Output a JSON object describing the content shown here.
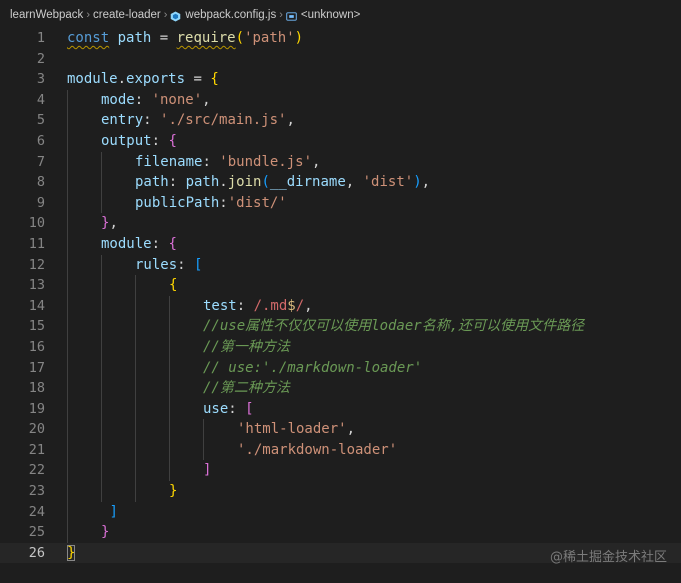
{
  "breadcrumb": {
    "items": [
      "learnWebpack",
      "create-loader",
      "webpack.config.js",
      "<unknown>"
    ],
    "separator": "›"
  },
  "code": {
    "lines": [
      {
        "n": "1",
        "indent": 0,
        "tokens": [
          [
            "kw",
            "const"
          ],
          [
            "op",
            " "
          ],
          [
            "var",
            "path"
          ],
          [
            "op",
            " = "
          ],
          [
            "fn",
            "require"
          ],
          [
            "b1",
            "("
          ],
          [
            "str",
            "'path'"
          ],
          [
            "b1",
            ")"
          ]
        ]
      },
      {
        "n": "2",
        "indent": 0,
        "tokens": []
      },
      {
        "n": "3",
        "indent": 0,
        "tokens": [
          [
            "var",
            "module"
          ],
          [
            "op",
            "."
          ],
          [
            "var",
            "exports"
          ],
          [
            "op",
            " = "
          ],
          [
            "b1",
            "{"
          ]
        ]
      },
      {
        "n": "4",
        "indent": 1,
        "tokens": [
          [
            "prop",
            "mode"
          ],
          [
            "op",
            ": "
          ],
          [
            "str",
            "'none'"
          ],
          [
            "op",
            ","
          ]
        ]
      },
      {
        "n": "5",
        "indent": 1,
        "tokens": [
          [
            "prop",
            "entry"
          ],
          [
            "op",
            ": "
          ],
          [
            "str",
            "'./src/main.js'"
          ],
          [
            "op",
            ","
          ]
        ]
      },
      {
        "n": "6",
        "indent": 1,
        "tokens": [
          [
            "prop",
            "output"
          ],
          [
            "op",
            ": "
          ],
          [
            "b2",
            "{"
          ]
        ]
      },
      {
        "n": "7",
        "indent": 2,
        "tokens": [
          [
            "prop",
            "filename"
          ],
          [
            "op",
            ": "
          ],
          [
            "str",
            "'bundle.js'"
          ],
          [
            "op",
            ","
          ]
        ]
      },
      {
        "n": "8",
        "indent": 2,
        "tokens": [
          [
            "prop",
            "path"
          ],
          [
            "op",
            ": "
          ],
          [
            "var",
            "path"
          ],
          [
            "op",
            "."
          ],
          [
            "fn",
            "join"
          ],
          [
            "b3",
            "("
          ],
          [
            "var",
            "__dirname"
          ],
          [
            "op",
            ", "
          ],
          [
            "str",
            "'dist'"
          ],
          [
            "b3",
            ")"
          ],
          [
            "op",
            ","
          ]
        ]
      },
      {
        "n": "9",
        "indent": 2,
        "tokens": [
          [
            "prop",
            "publicPath"
          ],
          [
            "op",
            ":"
          ],
          [
            "str",
            "'dist/'"
          ]
        ]
      },
      {
        "n": "10",
        "indent": 1,
        "tokens": [
          [
            "b2",
            "}"
          ],
          [
            "op",
            ","
          ]
        ]
      },
      {
        "n": "11",
        "indent": 1,
        "tokens": [
          [
            "prop",
            "module"
          ],
          [
            "op",
            ": "
          ],
          [
            "b2",
            "{"
          ]
        ]
      },
      {
        "n": "12",
        "indent": 2,
        "tokens": [
          [
            "prop",
            "rules"
          ],
          [
            "op",
            ": "
          ],
          [
            "b3",
            "["
          ]
        ]
      },
      {
        "n": "13",
        "indent": 3,
        "tokens": [
          [
            "b1",
            "{"
          ]
        ]
      },
      {
        "n": "14",
        "indent": 4,
        "tokens": [
          [
            "prop",
            "test"
          ],
          [
            "op",
            ": "
          ],
          [
            "re",
            "/.md"
          ],
          [
            "reop",
            "$"
          ],
          [
            "re",
            "/"
          ],
          [
            "op",
            ","
          ]
        ]
      },
      {
        "n": "15",
        "indent": 4,
        "tokens": [
          [
            "cm",
            "//use属性不仅仅可以使用lodaer名称,还可以使用文件路径"
          ]
        ]
      },
      {
        "n": "16",
        "indent": 4,
        "tokens": [
          [
            "cm",
            "//第一种方法"
          ]
        ]
      },
      {
        "n": "17",
        "indent": 4,
        "tokens": [
          [
            "cm",
            "// use:'./markdown-loader'"
          ]
        ]
      },
      {
        "n": "18",
        "indent": 4,
        "tokens": [
          [
            "cm",
            "//第二种方法"
          ]
        ]
      },
      {
        "n": "19",
        "indent": 4,
        "tokens": [
          [
            "prop",
            "use"
          ],
          [
            "op",
            ": "
          ],
          [
            "b2",
            "["
          ]
        ]
      },
      {
        "n": "20",
        "indent": 5,
        "tokens": [
          [
            "str",
            "'html-loader'"
          ],
          [
            "op",
            ","
          ]
        ]
      },
      {
        "n": "21",
        "indent": 5,
        "tokens": [
          [
            "str",
            "'./markdown-loader'"
          ]
        ]
      },
      {
        "n": "22",
        "indent": 4,
        "tokens": [
          [
            "b2",
            "]"
          ]
        ]
      },
      {
        "n": "23",
        "indent": 3,
        "tokens": [
          [
            "b1",
            "}"
          ]
        ]
      },
      {
        "n": "24",
        "indent": 1,
        "pad": " ",
        "tokens": [
          [
            "b3",
            "]"
          ]
        ]
      },
      {
        "n": "25",
        "indent": 1,
        "tokens": [
          [
            "b2",
            "}"
          ]
        ]
      },
      {
        "n": "26",
        "indent": 0,
        "tokens": [
          [
            "b1",
            "}"
          ]
        ]
      }
    ]
  },
  "watermark": "@稀土掘金技术社区",
  "colors": {
    "background": "#1e1e1e",
    "keyword": "#569cd6",
    "variable": "#9cdcfe",
    "function": "#dcdcaa",
    "string": "#ce9178",
    "comment": "#6a9955",
    "regex": "#d16969",
    "bracket_level1": "#ffd700",
    "bracket_level2": "#da70d6",
    "bracket_level3": "#179fff"
  },
  "icons": {
    "file": "webpack-icon",
    "symbol": "symbol-variable-icon"
  }
}
